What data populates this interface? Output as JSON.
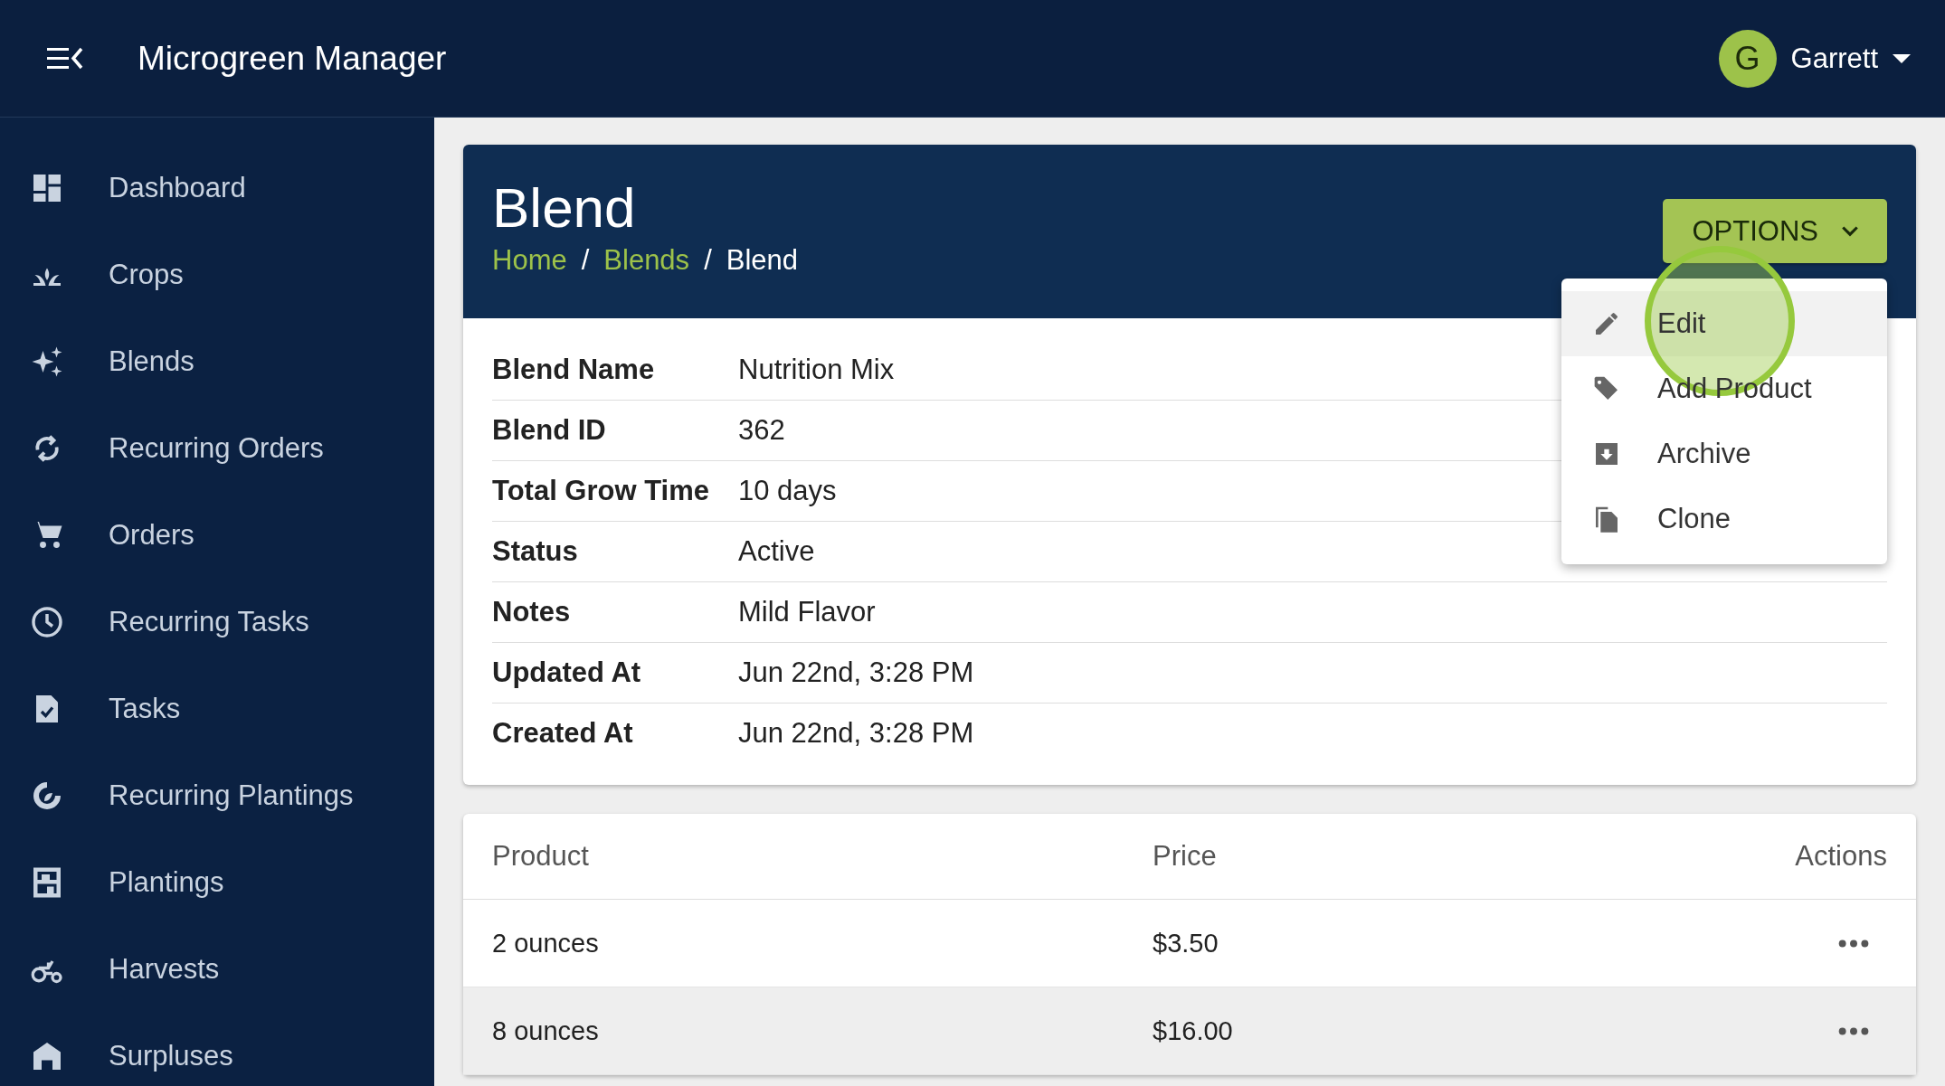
{
  "app_bar": {
    "title": "Microgreen Manager",
    "user": {
      "initial": "G",
      "name": "Garrett"
    }
  },
  "sidebar": {
    "items": [
      {
        "label": "Dashboard"
      },
      {
        "label": "Crops"
      },
      {
        "label": "Blends"
      },
      {
        "label": "Recurring Orders"
      },
      {
        "label": "Orders"
      },
      {
        "label": "Recurring Tasks"
      },
      {
        "label": "Tasks"
      },
      {
        "label": "Recurring Plantings"
      },
      {
        "label": "Plantings"
      },
      {
        "label": "Harvests"
      },
      {
        "label": "Surpluses"
      }
    ]
  },
  "page": {
    "title": "Blend",
    "breadcrumbs": [
      {
        "label": "Home",
        "link": true
      },
      {
        "label": "Blends",
        "link": true
      },
      {
        "label": "Blend",
        "link": false
      }
    ],
    "breadcrumb_separator": "/",
    "options_button": "OPTIONS",
    "options_menu": [
      {
        "label": "Edit",
        "selected": true
      },
      {
        "label": "Add Product",
        "selected": false
      },
      {
        "label": "Archive",
        "selected": false
      },
      {
        "label": "Clone",
        "selected": false
      }
    ]
  },
  "details": [
    {
      "label": "Blend Name",
      "value": "Nutrition Mix"
    },
    {
      "label": "Blend ID",
      "value": "362"
    },
    {
      "label": "Total Grow Time",
      "value": "10 days"
    },
    {
      "label": "Status",
      "value": "Active"
    },
    {
      "label": "Notes",
      "value": "Mild Flavor"
    },
    {
      "label": "Updated At",
      "value": "Jun 22nd, 3:28 PM"
    },
    {
      "label": "Created At",
      "value": "Jun 22nd, 3:28 PM"
    }
  ],
  "products_table": {
    "columns": [
      "Product",
      "Price",
      "Actions"
    ],
    "rows": [
      {
        "product": "2 ounces",
        "price": "$3.50",
        "selected": false
      },
      {
        "product": "8 ounces",
        "price": "$16.00",
        "selected": true
      }
    ]
  }
}
